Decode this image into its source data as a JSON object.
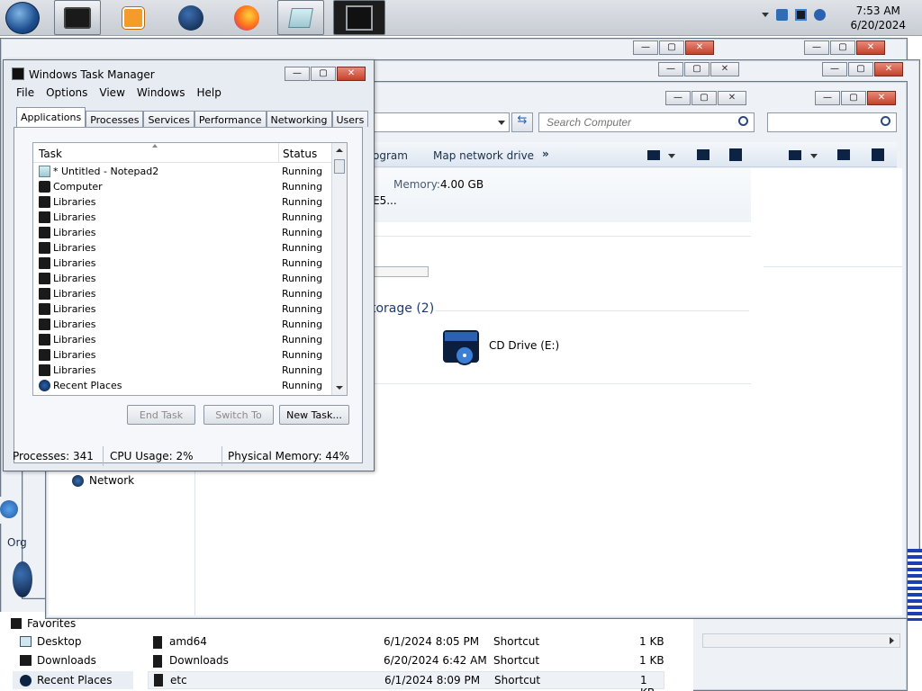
{
  "taskbar": {
    "clock_time": "7:53 AM",
    "clock_date": "6/20/2024"
  },
  "explorer_front": {
    "search_placeholder": "Search Computer",
    "toolbar_program": "ogram",
    "toolbar_map_drive": "Map network drive",
    "toolbar_more": "»",
    "memory_label": "Memory:",
    "memory_value": "4.00 GB",
    "truncated_text": "E5...",
    "section_storage": "torage (2)",
    "cd_drive_label": "CD Drive (E:)",
    "nav_network": "Network"
  },
  "explorer_back": {
    "organize_label": "Org",
    "favorites": "Favorites",
    "nav_items": [
      "Desktop",
      "Downloads",
      "Recent Places"
    ],
    "files": [
      {
        "name": "amd64",
        "date": "6/1/2024 8:05 PM",
        "type": "Shortcut",
        "size": "1 KB"
      },
      {
        "name": "Downloads",
        "date": "6/20/2024 6:42 AM",
        "type": "Shortcut",
        "size": "1 KB"
      },
      {
        "name": "etc",
        "date": "6/1/2024 8:09 PM",
        "type": "Shortcut",
        "size": "1 KB"
      }
    ]
  },
  "task_manager": {
    "title": "Windows Task Manager",
    "menu": [
      "File",
      "Options",
      "View",
      "Windows",
      "Help"
    ],
    "tabs": [
      "Applications",
      "Processes",
      "Services",
      "Performance",
      "Networking",
      "Users"
    ],
    "columns": {
      "task": "Task",
      "status": "Status"
    },
    "rows": [
      {
        "name": "* Untitled - Notepad2",
        "status": "Running",
        "icon": "notepad-icon"
      },
      {
        "name": "Computer",
        "status": "Running",
        "icon": "computer-icon"
      },
      {
        "name": "Libraries",
        "status": "Running",
        "icon": "libraries-icon"
      },
      {
        "name": "Libraries",
        "status": "Running",
        "icon": "libraries-icon"
      },
      {
        "name": "Libraries",
        "status": "Running",
        "icon": "libraries-icon"
      },
      {
        "name": "Libraries",
        "status": "Running",
        "icon": "libraries-icon"
      },
      {
        "name": "Libraries",
        "status": "Running",
        "icon": "libraries-icon"
      },
      {
        "name": "Libraries",
        "status": "Running",
        "icon": "libraries-icon"
      },
      {
        "name": "Libraries",
        "status": "Running",
        "icon": "libraries-icon"
      },
      {
        "name": "Libraries",
        "status": "Running",
        "icon": "libraries-icon"
      },
      {
        "name": "Libraries",
        "status": "Running",
        "icon": "libraries-icon"
      },
      {
        "name": "Libraries",
        "status": "Running",
        "icon": "libraries-icon"
      },
      {
        "name": "Libraries",
        "status": "Running",
        "icon": "libraries-icon"
      },
      {
        "name": "Libraries",
        "status": "Running",
        "icon": "libraries-icon"
      },
      {
        "name": "Recent Places",
        "status": "Running",
        "icon": "recent-places-icon"
      }
    ],
    "buttons": {
      "end_task": "End Task",
      "switch_to": "Switch To",
      "new_task": "New Task..."
    },
    "status_bar": {
      "processes": "Processes: 341",
      "cpu": "CPU Usage: 2%",
      "memory": "Physical Memory: 44%"
    }
  }
}
